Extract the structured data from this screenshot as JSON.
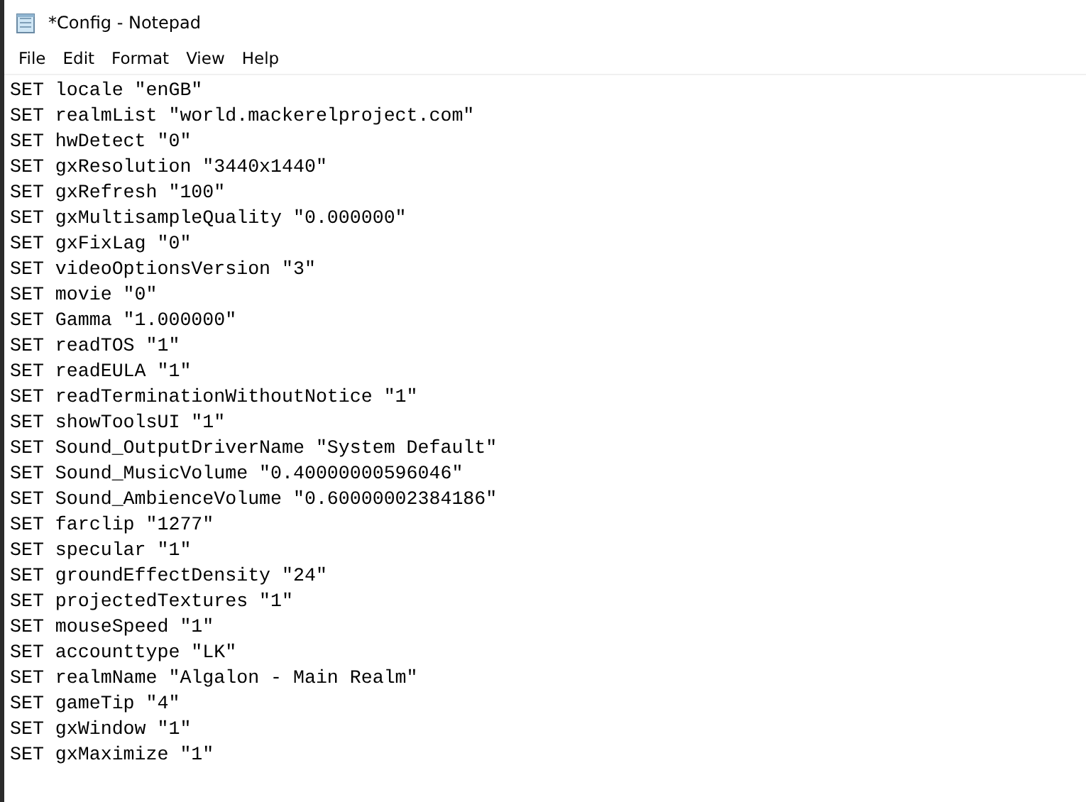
{
  "window": {
    "title": "*Config - Notepad"
  },
  "menu": [
    "File",
    "Edit",
    "Format",
    "View",
    "Help"
  ],
  "lines": [
    "SET locale \"enGB\"",
    "SET realmList \"world.mackerelproject.com\"",
    "SET hwDetect \"0\"",
    "SET gxResolution \"3440x1440\"",
    "SET gxRefresh \"100\"",
    "SET gxMultisampleQuality \"0.000000\"",
    "SET gxFixLag \"0\"",
    "SET videoOptionsVersion \"3\"",
    "SET movie \"0\"",
    "SET Gamma \"1.000000\"",
    "SET readTOS \"1\"",
    "SET readEULA \"1\"",
    "SET readTerminationWithoutNotice \"1\"",
    "SET showToolsUI \"1\"",
    "SET Sound_OutputDriverName \"System Default\"",
    "SET Sound_MusicVolume \"0.40000000596046\"",
    "SET Sound_AmbienceVolume \"0.60000002384186\"",
    "SET farclip \"1277\"",
    "SET specular \"1\"",
    "SET groundEffectDensity \"24\"",
    "SET projectedTextures \"1\"",
    "SET mouseSpeed \"1\"",
    "SET accounttype \"LK\"",
    "SET realmName \"Algalon - Main Realm\"",
    "SET gameTip \"4\"",
    "SET gxWindow \"1\"",
    "SET gxMaximize \"1\""
  ]
}
